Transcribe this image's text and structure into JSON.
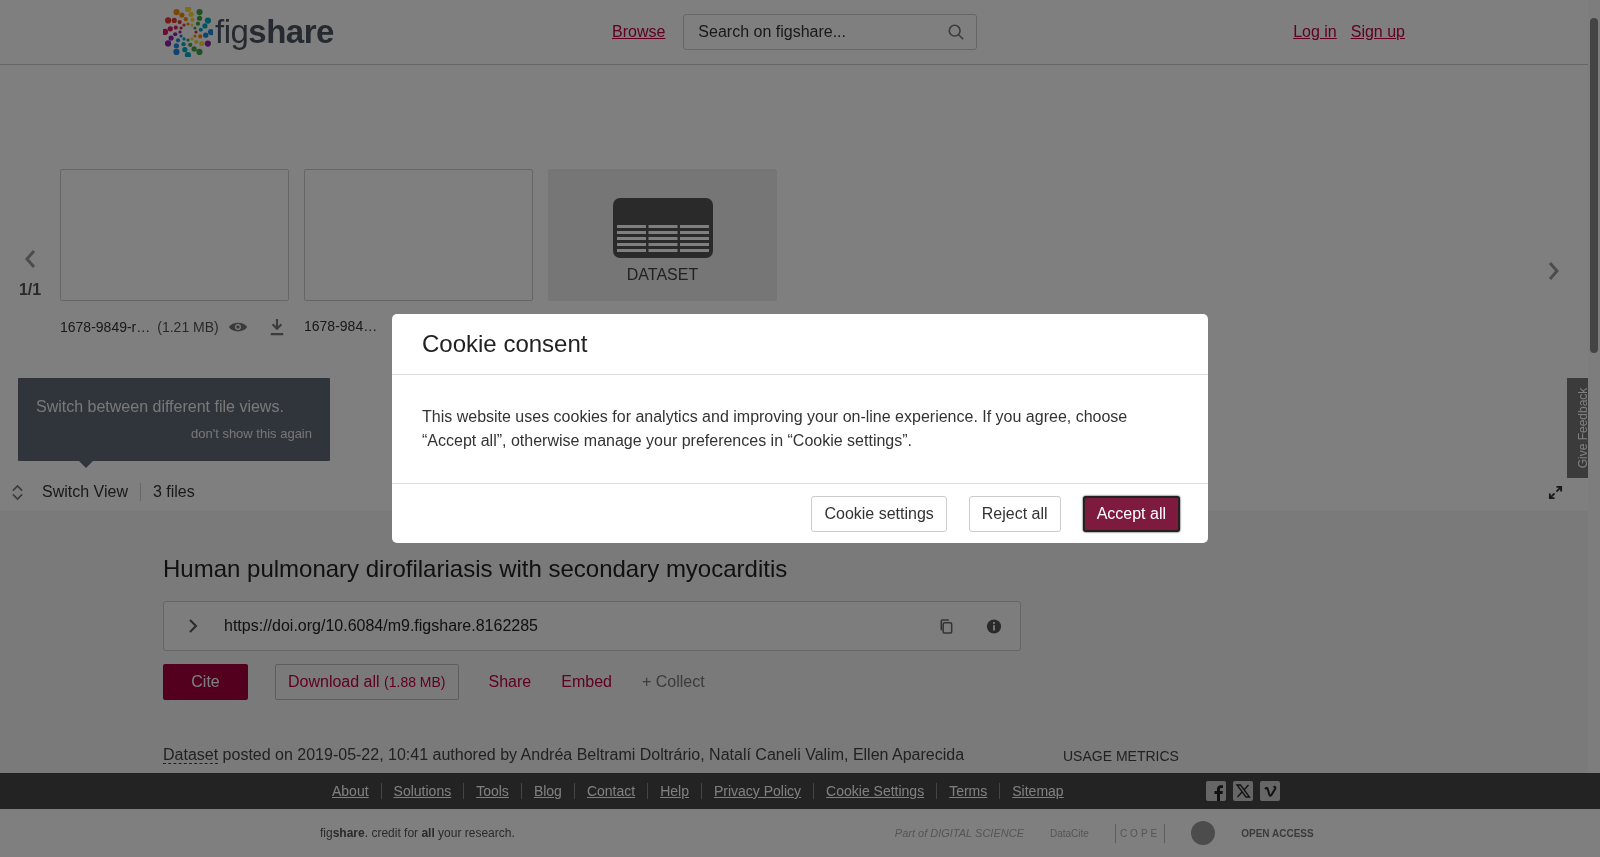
{
  "header": {
    "logo": "fig**share**",
    "browse": "Browse",
    "search": {
      "placeholder": "Search on figshare..."
    },
    "login": "Log in",
    "signup": "Sign up"
  },
  "carousel": {
    "page": "1/1",
    "items": [
      {
        "kind": "file",
        "name": "1678-9849-r…",
        "size": "(1.21 MB)"
      },
      {
        "kind": "file",
        "name": "1678-984…"
      },
      {
        "kind": "dataset",
        "label": "DATASET"
      }
    ]
  },
  "tooltip": {
    "text": "Switch between different file views.",
    "dismiss": "don't show this again"
  },
  "view_bar": {
    "switch_view": "Switch View",
    "count": "3 files"
  },
  "article": {
    "title": "Human pulmonary dirofilariasis with secondary myocarditis",
    "doi": "https://doi.org/10.6084/m9.figshare.8162285",
    "actions": {
      "cite": "Cite",
      "download": "Download all",
      "download_size": "(1.88 MB)",
      "share": "Share",
      "embed": "Embed",
      "collect": "+ Collect"
    },
    "item_type": "Dataset",
    "posted": "posted on 2019-05-22, 10:41 authored by Andréa Beltrami Doltrário, Natalí Caneli Valim, Ellen Aparecida",
    "usage_heading": "USAGE METRICS"
  },
  "feedback": "Give Feedback",
  "footer": {
    "links": [
      "About",
      "Solutions",
      "Tools",
      "Blog",
      "Contact",
      "Help",
      "Privacy Policy",
      "Cookie Settings",
      "Terms",
      "Sitemap"
    ],
    "tagline": "fig**share**. credit for **all** your research.",
    "partners": {
      "digital_science": "Part of DIGITAL SCIENCE",
      "datacite": "DataCite",
      "cope": "COPE",
      "open_access": "OPEN ACCESS"
    }
  },
  "modal": {
    "title": "Cookie consent",
    "body": "This website uses cookies for analytics and improving your on-line experience. If you agree, choose “Accept all”, otherwise manage your preferences in “Cookie settings”.",
    "buttons": [
      {
        "label": "Cookie settings",
        "kind": "secondary"
      },
      {
        "label": "Reject all",
        "kind": "secondary"
      },
      {
        "label": "Accept all",
        "kind": "primary"
      }
    ]
  }
}
